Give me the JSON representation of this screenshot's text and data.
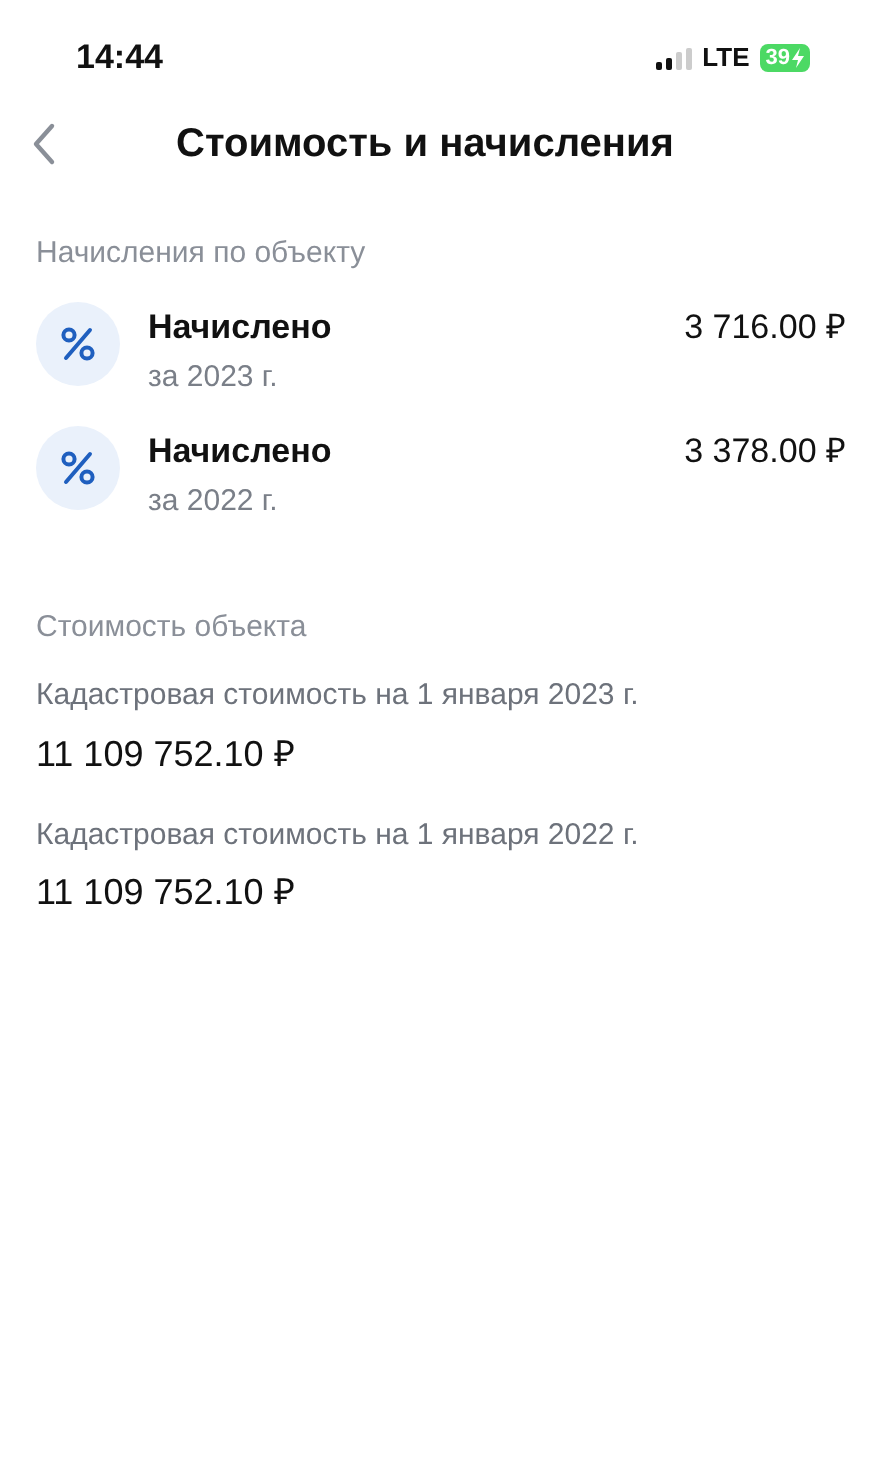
{
  "status_bar": {
    "time": "14:44",
    "network": "LTE",
    "battery": "39"
  },
  "header": {
    "title": "Стоимость и начисления"
  },
  "charges": {
    "title": "Начисления по объекту",
    "items": [
      {
        "label": "Начислено",
        "period": "за 2023 г.",
        "amount": "3 716.00 ₽"
      },
      {
        "label": "Начислено",
        "period": "за 2022 г.",
        "amount": "3 378.00 ₽"
      }
    ]
  },
  "values": {
    "title": "Стоимость объекта",
    "items": [
      {
        "label": "Кадастровая стоимость на 1 января 2023 г.",
        "amount": "11 109 752.10 ₽"
      },
      {
        "label": "Кадастровая стоимость на 1 января 2022 г.",
        "amount": "11 109 752.10 ₽"
      }
    ]
  }
}
